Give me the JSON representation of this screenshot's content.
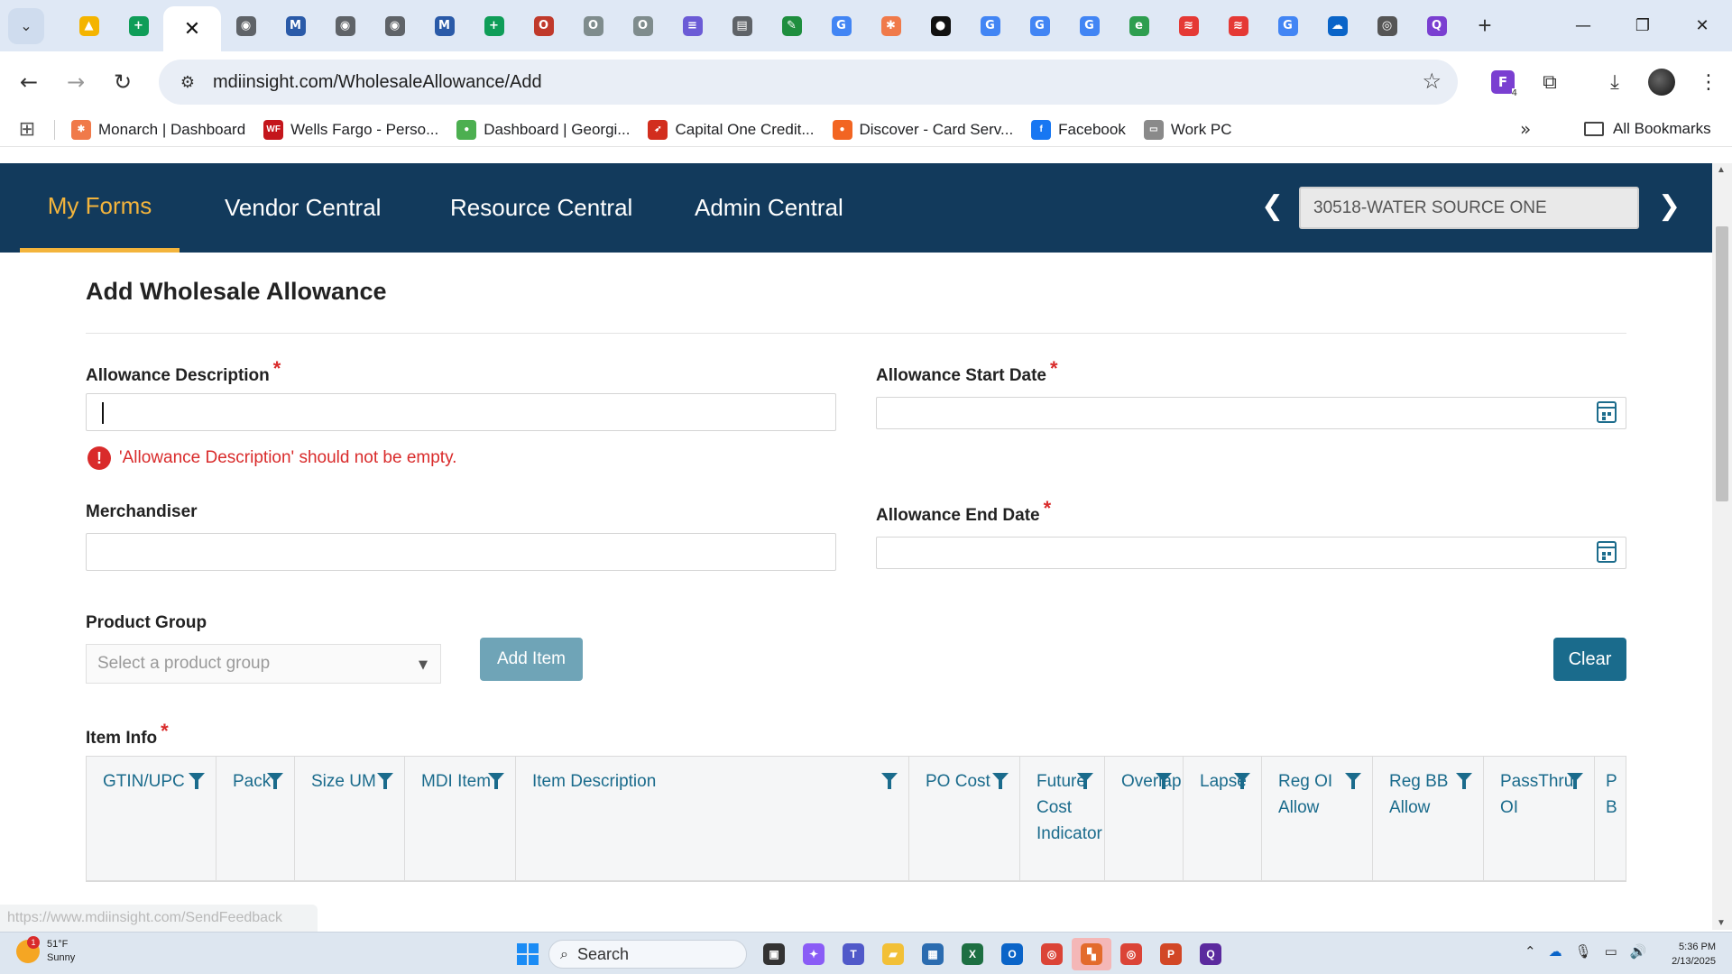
{
  "browser": {
    "tabs": [
      {
        "icon": "google-drive-icon",
        "color": "#f4b400",
        "glyph": "▲"
      },
      {
        "icon": "google-sheets-icon",
        "color": "#0f9d58",
        "glyph": "+"
      },
      {
        "icon": "close-icon",
        "color": "",
        "glyph": "✕",
        "active": true
      },
      {
        "icon": "globe-icon",
        "color": "#5f6368",
        "glyph": "◉"
      },
      {
        "icon": "mdi-m-icon",
        "color": "#2a5aa8",
        "glyph": "M"
      },
      {
        "icon": "globe-icon",
        "color": "#5f6368",
        "glyph": "◉"
      },
      {
        "icon": "globe-icon",
        "color": "#5f6368",
        "glyph": "◉"
      },
      {
        "icon": "mdi-m-icon",
        "color": "#2a5aa8",
        "glyph": "M"
      },
      {
        "icon": "google-sheets-icon",
        "color": "#0f9d58",
        "glyph": "+"
      },
      {
        "icon": "opc-icon",
        "color": "#c0392b",
        "glyph": "O"
      },
      {
        "icon": "opc-icon",
        "color": "#7f8c8d",
        "glyph": "O"
      },
      {
        "icon": "opc-icon",
        "color": "#7f8c8d",
        "glyph": "O"
      },
      {
        "icon": "form-icon",
        "color": "#6b5bd6",
        "glyph": "≡"
      },
      {
        "icon": "notes-icon",
        "color": "#5f6368",
        "glyph": "▤"
      },
      {
        "icon": "leaf-icon",
        "color": "#1e8e3e",
        "glyph": "✎"
      },
      {
        "icon": "google-icon",
        "color": "#4285f4",
        "glyph": "G"
      },
      {
        "icon": "monarch-icon",
        "color": "#f07a4a",
        "glyph": "✱"
      },
      {
        "icon": "circle-app-icon",
        "color": "#111111",
        "glyph": "●"
      },
      {
        "icon": "google-icon",
        "color": "#4285f4",
        "glyph": "G"
      },
      {
        "icon": "google-icon",
        "color": "#4285f4",
        "glyph": "G"
      },
      {
        "icon": "google-icon",
        "color": "#4285f4",
        "glyph": "G"
      },
      {
        "icon": "edge-icon",
        "color": "#2e9e4f",
        "glyph": "e"
      },
      {
        "icon": "red-app-icon",
        "color": "#e53935",
        "glyph": "≋"
      },
      {
        "icon": "red-app-icon",
        "color": "#e53935",
        "glyph": "≋"
      },
      {
        "icon": "google-icon",
        "color": "#4285f4",
        "glyph": "G"
      },
      {
        "icon": "onedrive-icon",
        "color": "#0a64c8",
        "glyph": "☁"
      },
      {
        "icon": "chrome-icon",
        "color": "#555555",
        "glyph": "◎"
      },
      {
        "icon": "qualtrics-icon",
        "color": "#7a3fd1",
        "glyph": "Q"
      }
    ],
    "url": "mdiinsight.com/WholesaleAllowance/Add",
    "extension_count": "4",
    "bookmarks": [
      {
        "label": "Monarch | Dashboard",
        "color": "#f07a4a",
        "glyph": "✱"
      },
      {
        "label": "Wells Fargo - Perso...",
        "color": "#c4161c",
        "glyph": "WF"
      },
      {
        "label": "Dashboard | Georgi...",
        "color": "#4caf50",
        "glyph": "●"
      },
      {
        "label": "Capital One Credit...",
        "color": "#d22e1e",
        "glyph": "➶"
      },
      {
        "label": "Discover - Card Serv...",
        "color": "#f26522",
        "glyph": "●"
      },
      {
        "label": "Facebook",
        "color": "#1877f2",
        "glyph": "f"
      },
      {
        "label": "Work PC",
        "color": "#8a8a8a",
        "glyph": "▭"
      }
    ],
    "all_bookmarks": "All Bookmarks",
    "status_url": "https://www.mdiinsight.com/SendFeedback"
  },
  "app": {
    "nav": [
      {
        "label": "My Forms",
        "active": true
      },
      {
        "label": "Vendor Central"
      },
      {
        "label": "Resource Central"
      },
      {
        "label": "Admin Central"
      }
    ],
    "account": "30518-WATER SOURCE ONE"
  },
  "form": {
    "title": "Add Wholesale Allowance",
    "required_mark": "*",
    "allowance_description_label": "Allowance Description",
    "allowance_description_value": "",
    "allowance_description_error": "'Allowance Description' should not be empty.",
    "allowance_start_date_label": "Allowance Start Date",
    "merchandiser_label": "Merchandiser",
    "allowance_end_date_label": "Allowance End Date",
    "product_group_label": "Product Group",
    "product_group_placeholder": "Select a product group",
    "add_item_label": "Add Item",
    "clear_label": "Clear",
    "item_info_label": "Item Info"
  },
  "grid": {
    "columns": [
      "GTIN/UPC",
      "Pack",
      "Size UM",
      "MDI Item",
      "Item Description",
      "PO Cost",
      "Future Cost Indicator",
      "Overlap",
      "Lapse",
      "Reg OI Allow",
      "Reg BB Allow",
      "PassThru OI",
      "P B"
    ]
  },
  "taskbar": {
    "weather_temp": "51°F",
    "weather_cond": "Sunny",
    "weather_badge": "1",
    "search_label": "Search",
    "time": "5:36 PM",
    "date": "2/13/2025",
    "apps": [
      {
        "icon": "task-view-icon",
        "color": "#333333",
        "glyph": "▣"
      },
      {
        "icon": "copilot-icon",
        "color": "#8a5cf6",
        "glyph": "✦"
      },
      {
        "icon": "teams-icon",
        "color": "#5059c9",
        "glyph": "T"
      },
      {
        "icon": "file-explorer-icon",
        "color": "#f2c037",
        "glyph": "▰"
      },
      {
        "icon": "store-icon",
        "color": "#2b6cb0",
        "glyph": "▦"
      },
      {
        "icon": "excel-icon",
        "color": "#1d6f42",
        "glyph": "X"
      },
      {
        "icon": "outlook-icon",
        "color": "#0a64c8",
        "glyph": "O"
      },
      {
        "icon": "chrome-icon",
        "color": "#db4437",
        "glyph": "◎"
      },
      {
        "icon": "remote-desktop-icon",
        "color": "#e36b2c",
        "glyph": "▚",
        "highlight": true
      },
      {
        "icon": "chrome-icon",
        "color": "#db4437",
        "glyph": "◎"
      },
      {
        "icon": "powerpoint-icon",
        "color": "#d24726",
        "glyph": "P"
      },
      {
        "icon": "qualtrics-icon",
        "color": "#5b2a9e",
        "glyph": "Q"
      }
    ]
  }
}
